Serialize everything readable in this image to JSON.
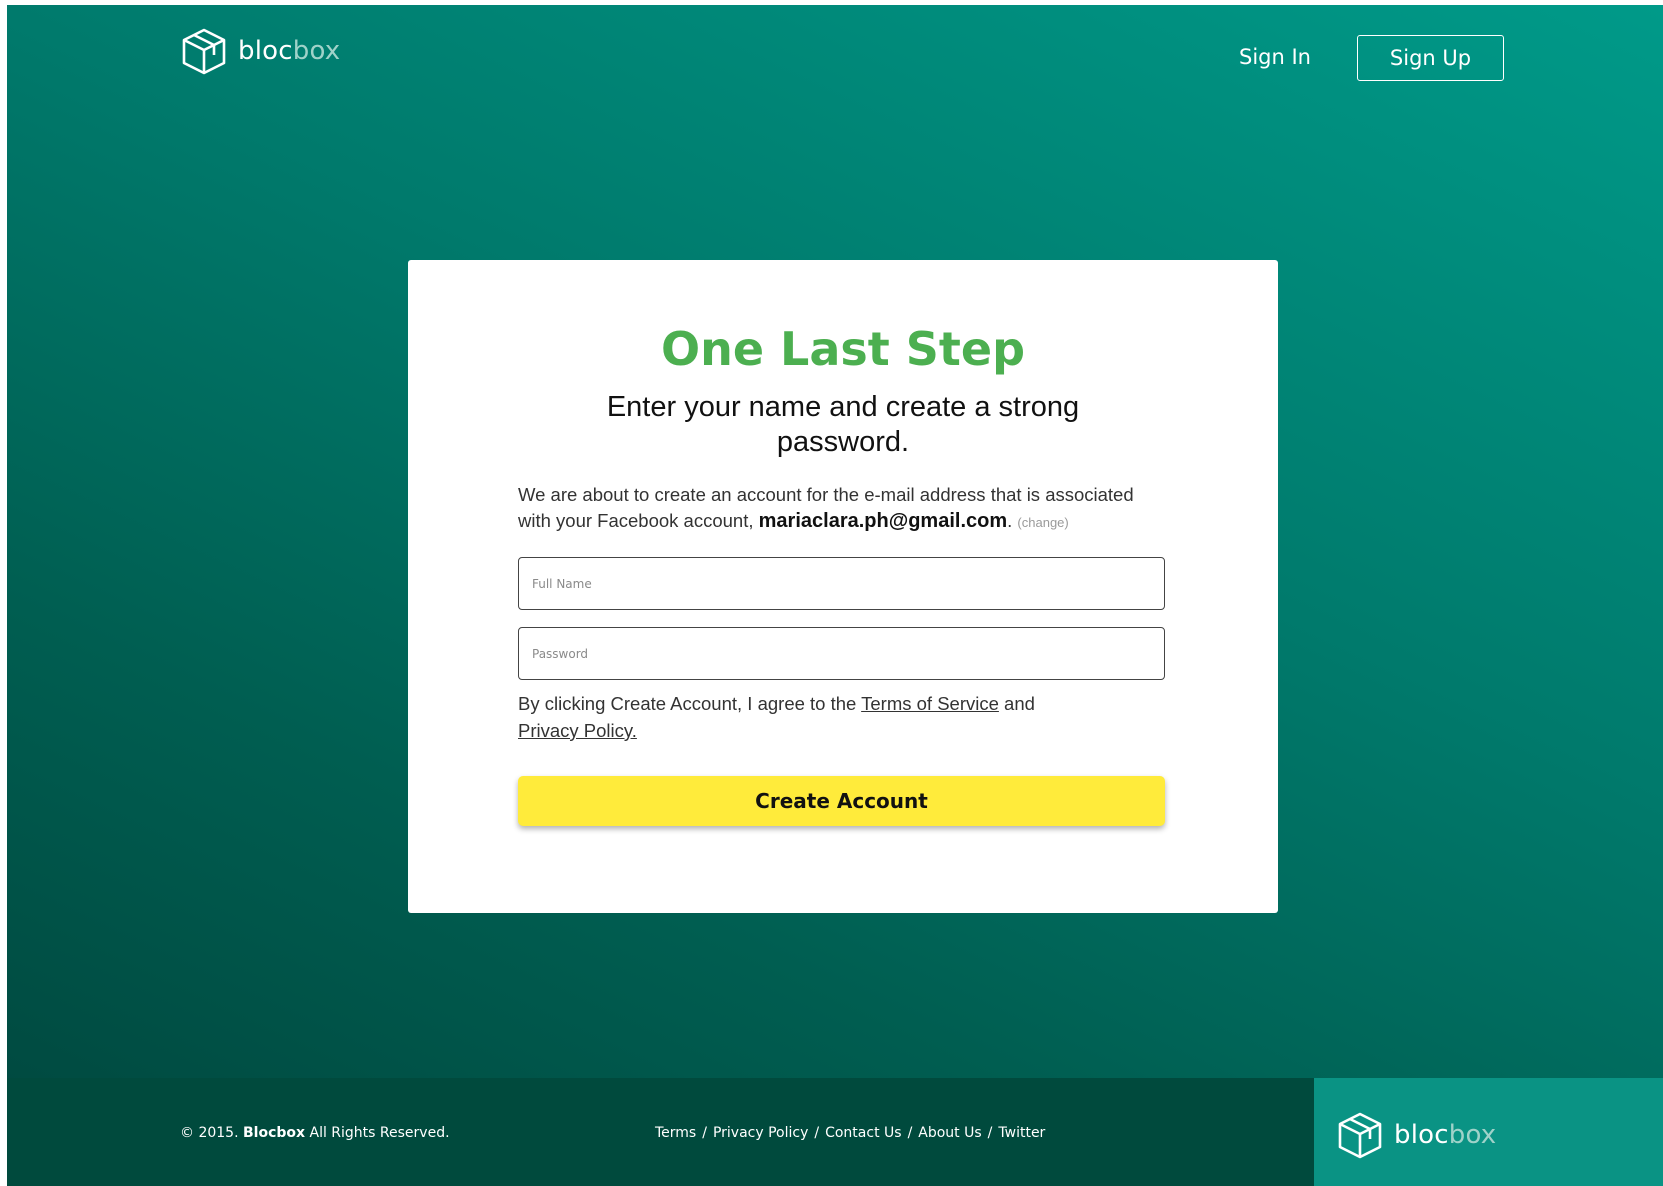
{
  "brand": {
    "name_part1": "bloc",
    "name_part2": "box"
  },
  "nav": {
    "sign_in": "Sign In",
    "sign_up": "Sign Up"
  },
  "card": {
    "title": "One Last Step",
    "subtitle": "Enter your name and create a strong password.",
    "description_prefix": "We are about to create an account for the e-mail address that is associated with your Facebook account,",
    "email": "mariaclara.ph@gmail.com",
    "email_suffix": ".",
    "change_link": "(change)",
    "full_name": {
      "value": "",
      "placeholder": "Full Name"
    },
    "password": {
      "value": "",
      "placeholder": "Password"
    },
    "agree_prefix": "By clicking Create Account, I agree to the",
    "terms_link": "Terms of Service",
    "agree_and": "and",
    "privacy_link": "Privacy Policy.",
    "create_button": "Create Account"
  },
  "footer": {
    "copyright_prefix": "© 2015.",
    "copyright_brand": "Blocbox",
    "copyright_suffix": "All Rights Reserved.",
    "links": [
      "Terms",
      "Privacy Policy",
      "Contact Us",
      "About Us",
      "Twitter"
    ],
    "separator": "/"
  },
  "colors": {
    "accent_green": "#4caf50",
    "button_yellow": "#ffeb3b",
    "bg_teal": "#00796b",
    "footer_dark": "#004a3d",
    "footer_brand": "#0a9384"
  },
  "icons": {
    "logo": "cube-icon"
  }
}
